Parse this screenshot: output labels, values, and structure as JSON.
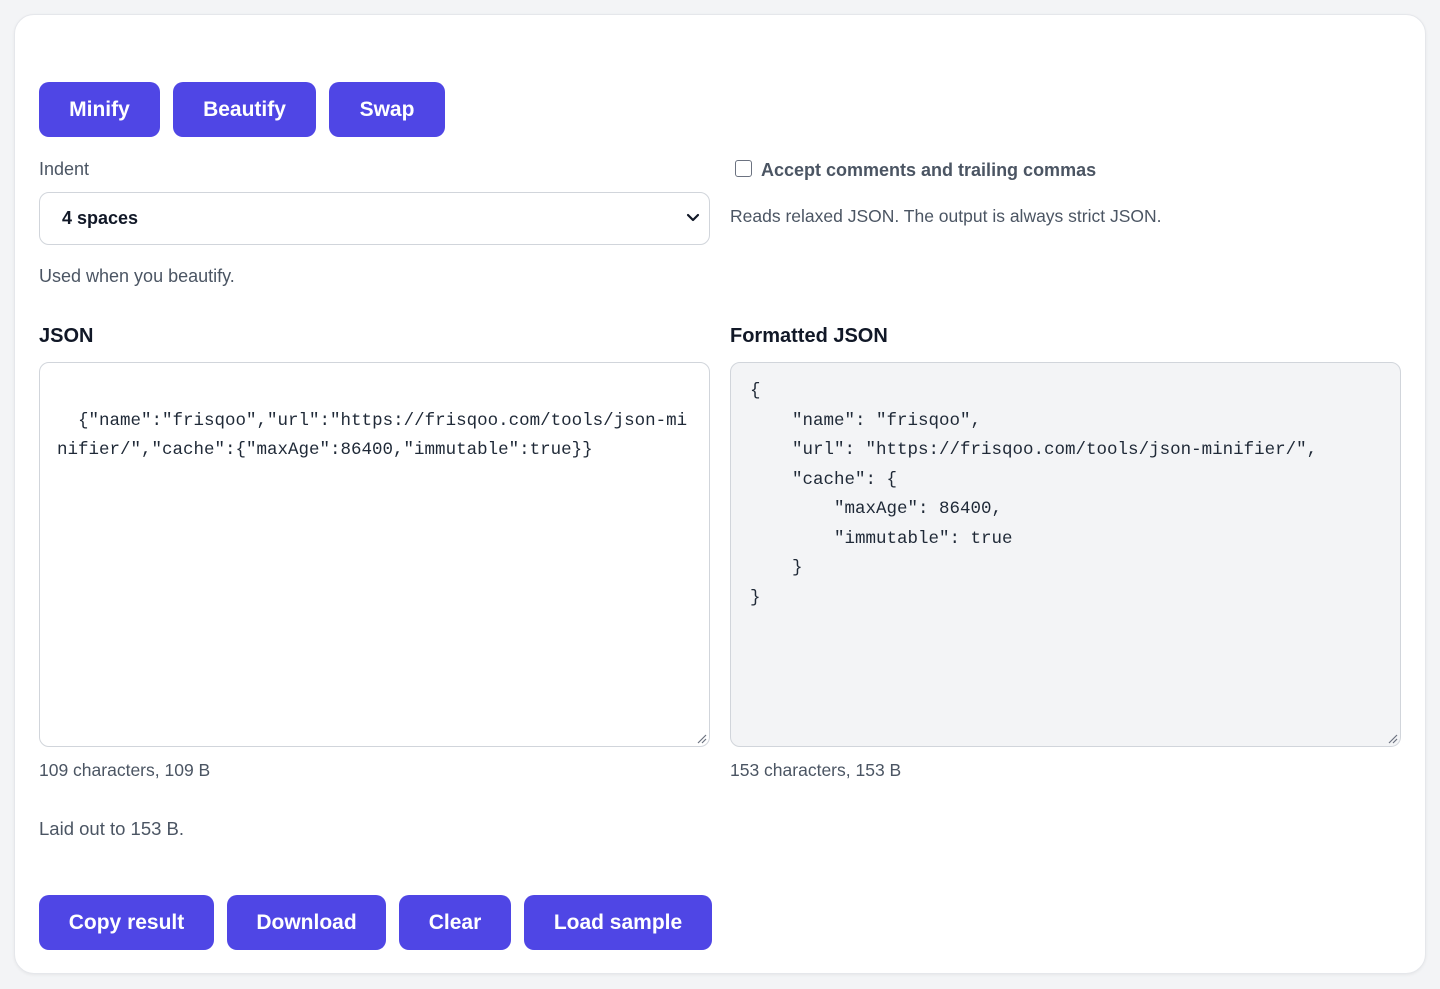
{
  "toolbar": {
    "minify": "Minify",
    "beautify": "Beautify",
    "swap": "Swap"
  },
  "indent": {
    "label": "Indent",
    "selected": "4 spaces",
    "help": "Used when you beautify."
  },
  "relaxed": {
    "label": "Accept comments and trailing commas",
    "checked": false,
    "help": "Reads relaxed JSON. The output is always strict JSON."
  },
  "input": {
    "title": "JSON",
    "value": "{\"name\":\"frisqoo\",\"url\":\"https://frisqoo.com/tools/json-minifier/\",\"cache\":{\"maxAge\":86400,\"immutable\":true}}",
    "stats": "109 characters, 109 B"
  },
  "output": {
    "title": "Formatted JSON",
    "value": "{\n    \"name\": \"frisqoo\",\n    \"url\": \"https://frisqoo.com/tools/json-minifier/\",\n    \"cache\": {\n        \"maxAge\": 86400,\n        \"immutable\": true\n    }\n}",
    "stats": "153 characters, 153 B"
  },
  "status": "Laid out to 153 B.",
  "actions": {
    "copy": "Copy result",
    "download": "Download",
    "clear": "Clear",
    "load_sample": "Load sample"
  },
  "colors": {
    "accent": "#4f46e5",
    "output_bg": "#f3f4f6"
  }
}
